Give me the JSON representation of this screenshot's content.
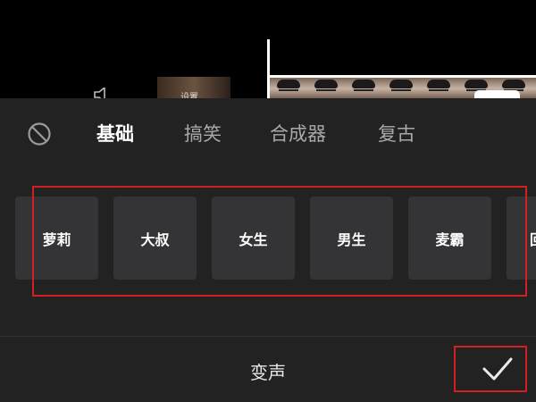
{
  "preview": {
    "thumb_text": "设置"
  },
  "effects": {
    "tabs": [
      {
        "label": "基础",
        "active": true
      },
      {
        "label": "搞笑",
        "active": false
      },
      {
        "label": "合成器",
        "active": false
      },
      {
        "label": "复古",
        "active": false
      }
    ],
    "voices": [
      "萝莉",
      "大叔",
      "女生",
      "男生",
      "麦霸",
      "回"
    ]
  },
  "footer": {
    "title": "变声"
  },
  "icons": {
    "no_effect": "no-effect-icon",
    "confirm": "checkmark-icon",
    "volume": "speaker-icon"
  },
  "colors": {
    "sheet_background": "#222222",
    "voice_tile": "#343436",
    "active_tab": "#ffffff",
    "inactive_tab": "#a9a9a9",
    "highlight_box": "#d21f1f"
  }
}
